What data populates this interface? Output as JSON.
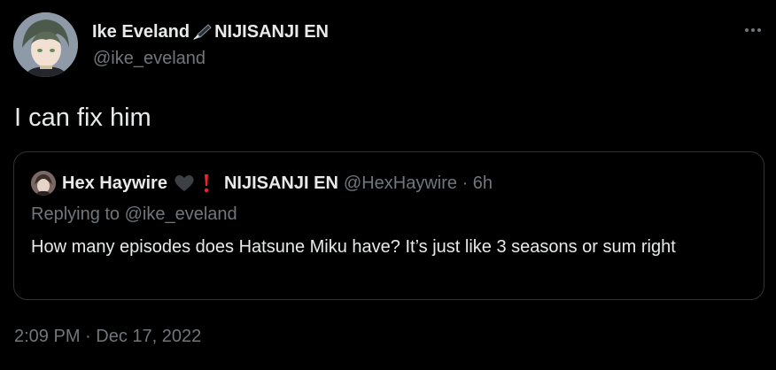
{
  "author": {
    "display_name": "Ike Eveland",
    "name_suffix": "NIJISANJI EN",
    "name_emoji": "fountain-pen-icon",
    "handle": "@ike_eveland"
  },
  "tweet": {
    "text": "I can fix him",
    "timestamp": "2:09 PM · Dec 17, 2022"
  },
  "quoted": {
    "display_name": "Hex Haywire",
    "name_emojis": [
      "black-heart-icon",
      "red-exclamation-icon"
    ],
    "org": "NIJISANJI EN",
    "handle_time": "@HexHaywire · 6h",
    "replying_to": "Replying to @ike_eveland",
    "text": "How many episodes does Hatsune Miku have? It’s just like 3 seasons or sum right"
  },
  "colors": {
    "background": "#000000",
    "primary_text": "#e7e9ea",
    "secondary_text": "#71767b",
    "border": "#2f3336",
    "exclamation": "#f4212e"
  }
}
